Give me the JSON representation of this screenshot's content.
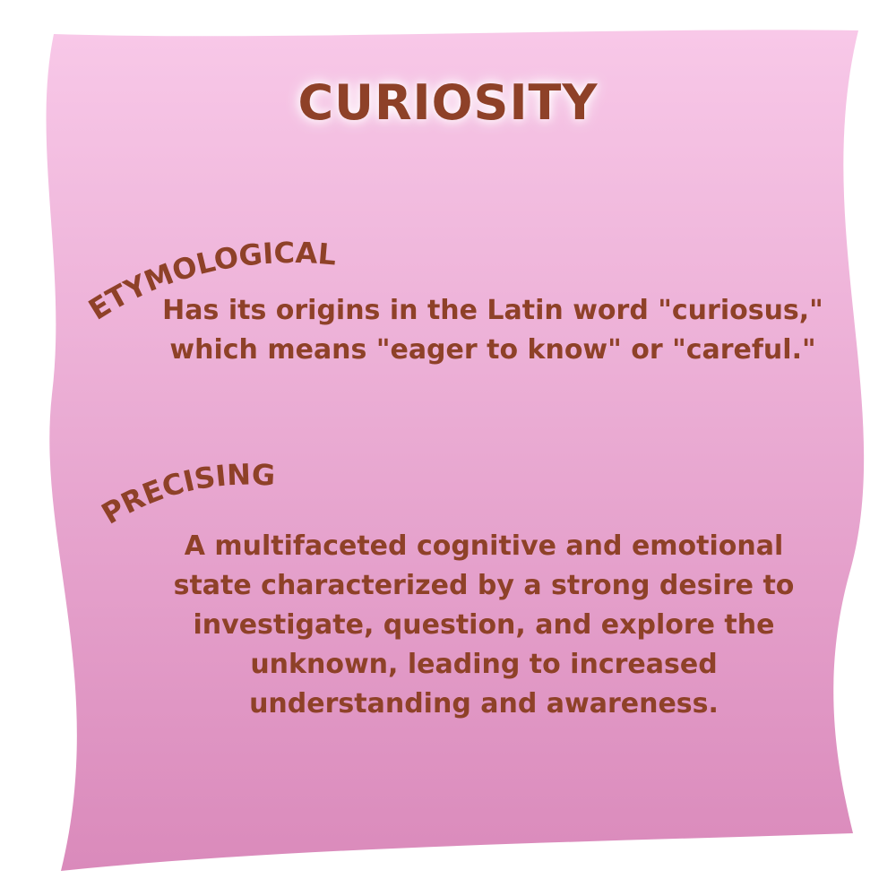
{
  "colors": {
    "paper_top": "#f8c8e8",
    "paper_bottom": "#da8abb",
    "text": "#8e4128",
    "title_glow": "#ffffff"
  },
  "card": {
    "title": "CURIOSITY",
    "sections": [
      {
        "heading": "ETYMOLOGICAL",
        "text": "Has its origins in the Latin word \"curiosus,\" which means \"eager to know\" or \"careful.\""
      },
      {
        "heading": "PRECISING",
        "text": "A multifaceted cognitive and emotional state characterized by a strong desire to investigate, question, and explore the unknown, leading to increased understanding and awareness."
      }
    ]
  }
}
